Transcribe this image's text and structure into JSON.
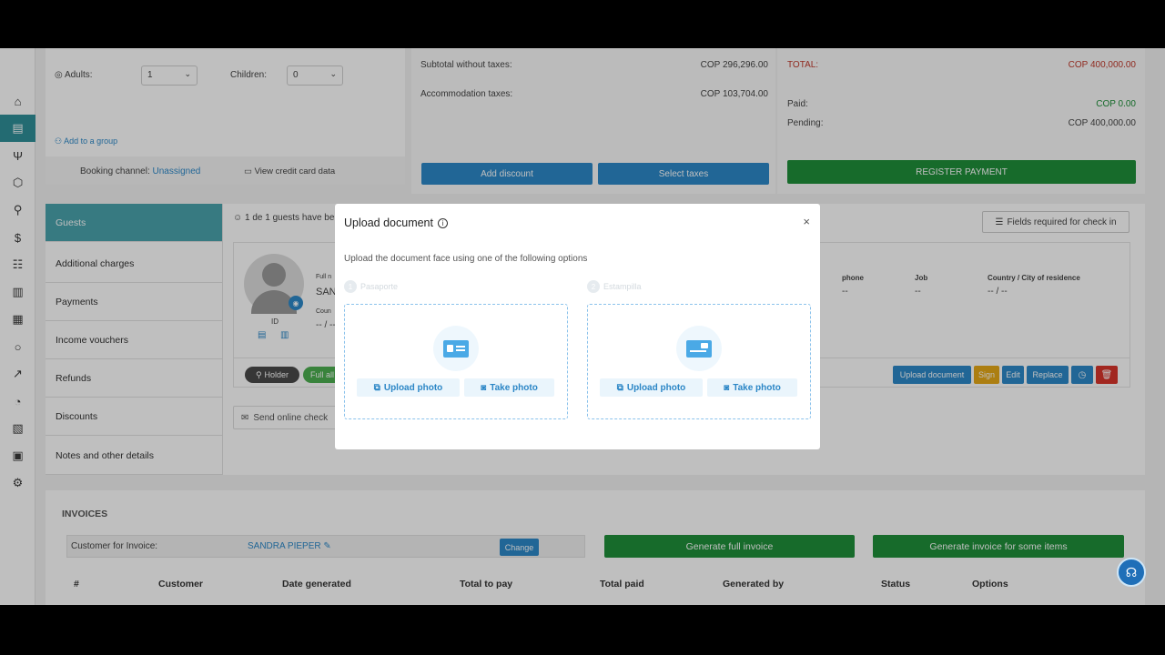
{
  "booking": {
    "adults_label": "Adults:",
    "adults_value": "1",
    "children_label": "Children:",
    "children_value": "0",
    "add_group": "Add to a group",
    "channel_label": "Booking channel:",
    "channel_value": "Unassigned",
    "view_card": "View credit card data"
  },
  "taxes": {
    "subtotal_label": "Subtotal without taxes:",
    "subtotal_value": "COP 296,296.00",
    "accom_label": "Accommodation taxes:",
    "accom_value": "COP 103,704.00",
    "add_discount": "Add discount",
    "select_taxes": "Select taxes"
  },
  "totals": {
    "total_label": "TOTAL:",
    "total_value": "COP 400,000.00",
    "paid_label": "Paid:",
    "paid_value": "COP 0.00",
    "pending_label": "Pending:",
    "pending_value": "COP 400,000.00",
    "register_payment": "REGISTER PAYMENT"
  },
  "side_menu": [
    "Guests",
    "Additional charges",
    "Payments",
    "Income vouchers",
    "Refunds",
    "Discounts",
    "Notes and other details"
  ],
  "guests": {
    "count_text": "1 de 1 guests have be",
    "fields_required": "Fields required for check in",
    "full_name_label": "Full n",
    "name_value": "SAN",
    "country_label": "Coun",
    "country_value": "-- / --",
    "id_label": "ID",
    "phone_label": "phone",
    "phone_value": "--",
    "job_label": "Job",
    "job_value": "--",
    "residence_label": "Country / City of residence",
    "residence_value": "-- / --",
    "holder_badge": "Holder",
    "full_badge": "Full all",
    "send_online": "Send online check",
    "actions": {
      "upload_document": "Upload document",
      "sign": "Sign",
      "edit": "Edit",
      "replace": "Replace"
    }
  },
  "invoices": {
    "title": "INVOICES",
    "customer_label": "Customer for Invoice:",
    "customer_value": "SANDRA PIEPER",
    "change": "Change",
    "generate_full": "Generate full invoice",
    "generate_some": "Generate invoice for some items",
    "columns": [
      "#",
      "Customer",
      "Date generated",
      "Total to pay",
      "Total paid",
      "Generated by",
      "Status",
      "Options"
    ]
  },
  "modal": {
    "title": "Upload document",
    "close": "×",
    "description": "Upload the document face using one of the following options",
    "steps": [
      {
        "num": "1",
        "label": "Pasaporte"
      },
      {
        "num": "2",
        "label": "Estampilla"
      }
    ],
    "upload_photo": "Upload photo",
    "take_photo": "Take photo"
  },
  "colors": {
    "primary_blue": "#2d89c8",
    "green": "#1f8f3a",
    "teal_active": "#4aa3ac",
    "total_red": "#c0392b"
  }
}
